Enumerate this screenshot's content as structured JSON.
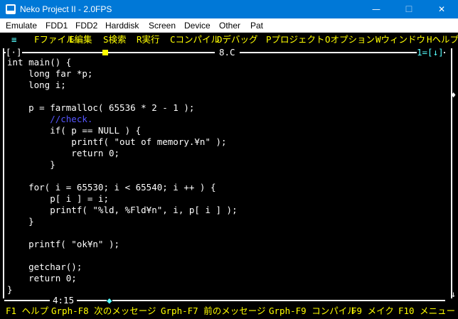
{
  "window": {
    "title": "Neko Project II - 2.0FPS"
  },
  "menubar": [
    "Emulate",
    "FDD1",
    "FDD2",
    "Harddisk",
    "Screen",
    "Device",
    "Other",
    "Pat"
  ],
  "dosmenu": [
    "≡",
    "Fファイル",
    "E編集",
    "S検索",
    "R実行",
    "Cコンパイル",
    "Dデバッグ",
    "Pプロジェクト",
    "Oオプション",
    "Wウィンドウ",
    "Hヘルプ"
  ],
  "editor": {
    "left_mark": "[·]",
    "title": "8.C",
    "right_mark": "1=[↓]",
    "position": "4:15",
    "lines": [
      "int main() {",
      "    long far *p;",
      "    long i;",
      "",
      "    p = farmalloc( 65536 * 2 - 1 );",
      "        //check.",
      "        if( p == NULL ) {",
      "            printf( \"out of memory.¥n\" );",
      "            return 0;",
      "        }",
      "",
      "    for( i = 65530; i < 65540; i ++ ) {",
      "        p[ i ] = i;",
      "        printf( \"%ld, %Fld¥n\", i, p[ i ] );",
      "    }",
      "",
      "    printf( \"ok¥n\" );",
      "",
      "    getchar();",
      "    return 0;",
      "}"
    ]
  },
  "statusbar": [
    "F1 ヘルプ",
    "Grph-F8 次のメッセージ",
    "Grph-F7 前のメッセージ",
    "Grph-F9 コンパイル",
    "F9 メイク",
    "F10 メニュー"
  ]
}
